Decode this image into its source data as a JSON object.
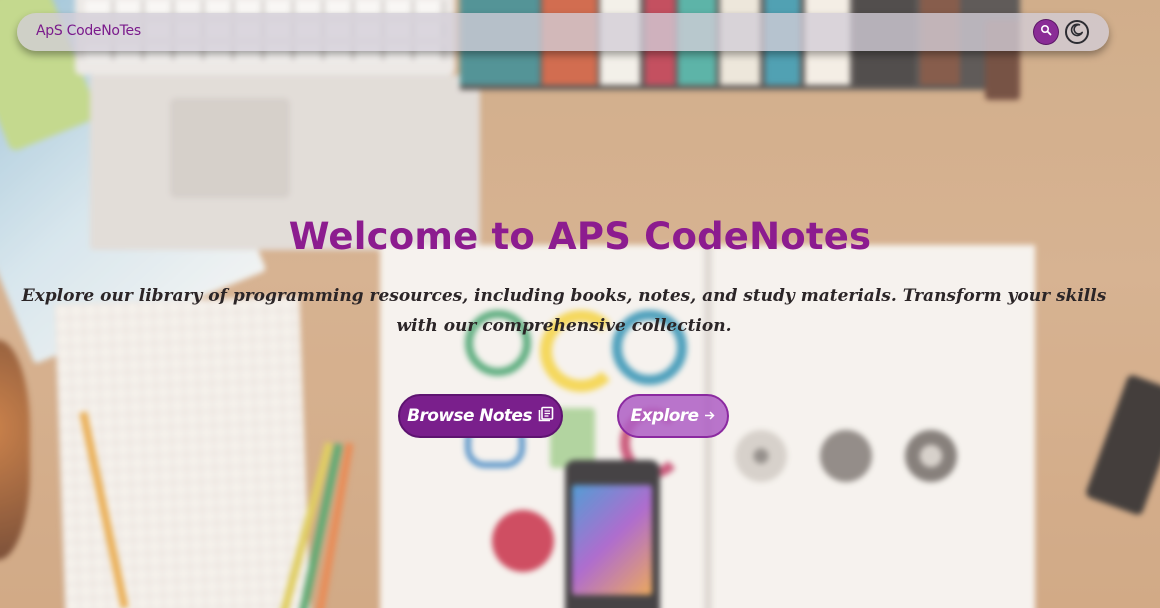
{
  "navbar": {
    "brand": "ApS CodeNoTes",
    "search_icon": "search-icon",
    "theme_icon": "moon-icon"
  },
  "hero": {
    "title": "Welcome to APS CodeNotes",
    "subtitle": "Explore our library of programming resources, including books, notes, and study materials. Transform your skills with our comprehensive collection.",
    "primary_button": {
      "label": "Browse Notes",
      "icon": "notes-icon"
    },
    "secondary_button": {
      "label": "Explore",
      "icon": "arrow-right-icon"
    }
  },
  "colors": {
    "accent": "#8c1c8f",
    "button_primary": "#7a1f8c",
    "button_secondary": "#ae5ec4",
    "subtitle_text": "#2b2527"
  }
}
